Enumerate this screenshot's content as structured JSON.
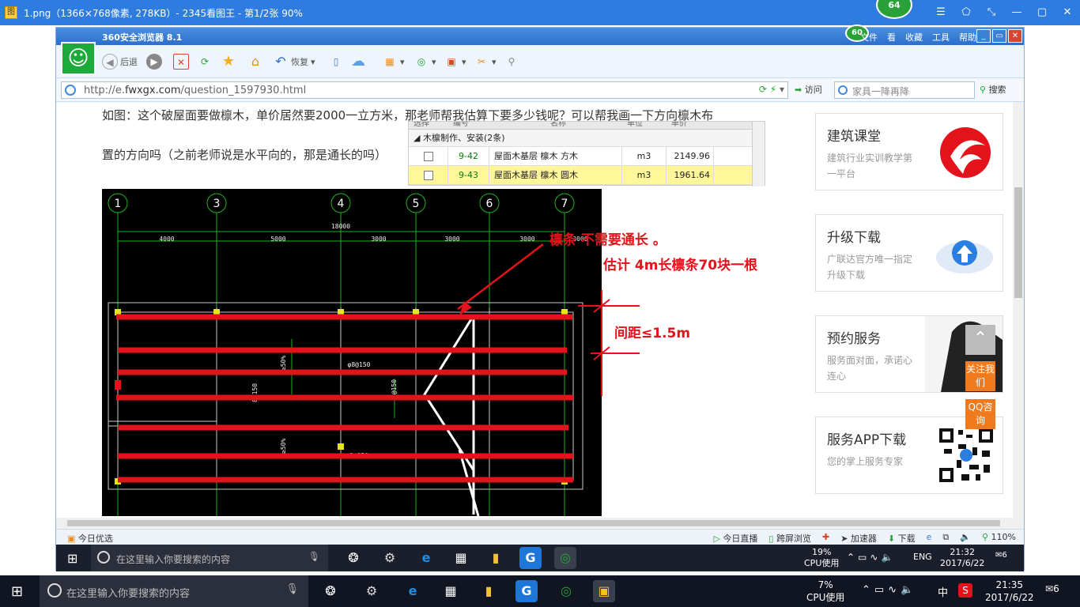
{
  "viewer": {
    "title": "1.png（1366×768像素, 278KB）- 2345看图王 - 第1/2张 90%",
    "app_icon": "图",
    "badge": "64",
    "controls": [
      "☰",
      "⬠",
      "⤡",
      "—",
      "▢",
      "✕"
    ]
  },
  "browser": {
    "name": "360安全浏览器 8.1",
    "badge": "60",
    "menu": [
      "文件",
      "看",
      "收藏",
      "工具",
      "帮助"
    ],
    "window_ctl": [
      "_",
      "▭",
      "✕"
    ],
    "toolbar": {
      "back": "后退",
      "restore": "恢复",
      "icons": [
        "forward-icon",
        "stop-icon",
        "refresh-icon",
        "favorite-icon",
        "home-icon",
        "phone-icon",
        "cloud-icon",
        "apps-icon",
        "shield-icon",
        "translate-icon",
        "screenshot-icon",
        "zoom-icon"
      ]
    },
    "address": {
      "url_prefix": "http://e.",
      "url_domain": "fwxgx.com",
      "url_path": "/question_1597930.html",
      "visit": "访问",
      "search_placeholder": "家具一降再降",
      "search_button": "搜索"
    },
    "status": {
      "left": "今日优选",
      "items": [
        "今日直播",
        "跨屏浏览",
        "加速器",
        "下载",
        "110%"
      ]
    }
  },
  "question": {
    "line1": "如图：这个破屋面要做檩木，单价居然要2000一立方米，那老师帮我估算下要多少钱呢？可以帮我画一下方向檩木布",
    "line2": "置的方向吗（之前老师说是水平向的，那是通长的吗）"
  },
  "rate_table": {
    "headers": [
      "选择",
      "编号",
      "名称",
      "单位",
      "单价"
    ],
    "group": "木檩制作、安装(2条)",
    "rows": [
      {
        "code": "9-42",
        "name": "屋面木基层 檩木 方木",
        "unit": "m3",
        "price": "2149.96",
        "selected": false
      },
      {
        "code": "9-43",
        "name": "屋面木基层 檩木 圆木",
        "unit": "m3",
        "price": "1961.64",
        "selected": true
      }
    ]
  },
  "drawing": {
    "axes": [
      "1",
      "3",
      "4",
      "5",
      "6",
      "7"
    ],
    "total_dim": "18000",
    "dims": [
      "4000",
      "5000",
      "3000",
      "3000",
      "3000",
      "3000"
    ],
    "notes": [
      "φ8@150",
      "≥50%",
      "8@150"
    ],
    "annotations": {
      "purlin_note": "檩条 不需要通长 。",
      "estimate": "估计 4m长檩条70块一根",
      "spacing": "间距≤1.5m"
    }
  },
  "sidebar": {
    "cards": [
      {
        "title": "建筑课堂",
        "desc": "建筑行业实训教学第一平台"
      },
      {
        "title": "升级下载",
        "desc": "广联达官方唯一指定升级下载"
      },
      {
        "title": "预约服务",
        "desc": "服务面对面，承诺心连心"
      },
      {
        "title": "服务APP下载",
        "desc": "您的掌上服务专家"
      }
    ],
    "float_buttons": [
      "关注我们",
      "QQ咨询"
    ]
  },
  "inner_taskbar": {
    "search_placeholder": "在这里输入你要搜索的内容",
    "cpu_pct": "19%",
    "cpu_label": "CPU使用",
    "lang": "ENG",
    "time": "21:32",
    "date": "2017/6/22",
    "notif": "6"
  },
  "taskbar": {
    "search_placeholder": "在这里输入你要搜索的内容",
    "cpu_pct": "7%",
    "cpu_label": "CPU使用",
    "ime": "中",
    "time": "21:35",
    "date": "2017/6/22",
    "notif": "6"
  },
  "colors": {
    "accent": "#2f7ce0",
    "annotation_red": "#e4121a",
    "brand_green": "#2aa138",
    "orange": "#f07a1e"
  }
}
